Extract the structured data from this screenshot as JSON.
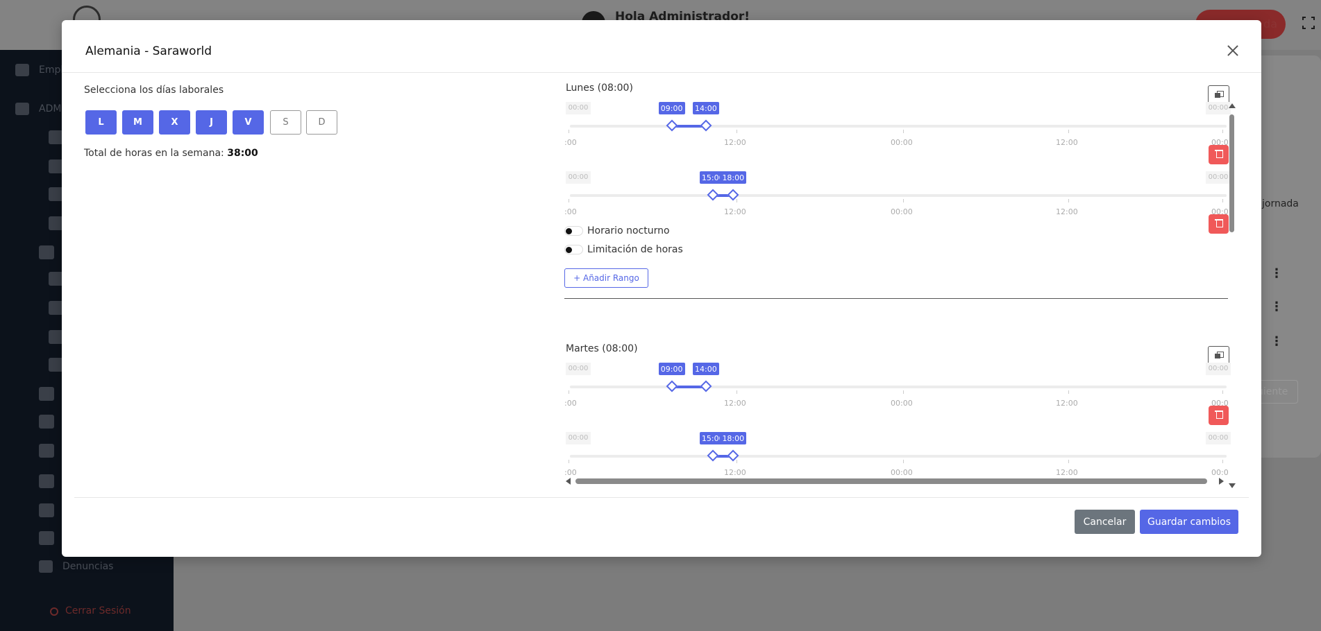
{
  "background": {
    "greeting": "Hola Administrador!",
    "header_button": "da",
    "sidebar": {
      "items": [
        "Empl",
        "ADMI"
      ],
      "bottom_item": "Denuncias",
      "logout": "Cerrar Sesión"
    },
    "main": {
      "jornada": "jornada",
      "siguiente": "uiente"
    }
  },
  "modal": {
    "title": "Alemania - Saraworld",
    "days_label": "Selecciona los días laborales",
    "days": [
      {
        "label": "L",
        "selected": true
      },
      {
        "label": "M",
        "selected": true
      },
      {
        "label": "X",
        "selected": true
      },
      {
        "label": "J",
        "selected": true
      },
      {
        "label": "V",
        "selected": true
      },
      {
        "label": "S",
        "selected": false
      },
      {
        "label": "D",
        "selected": false
      }
    ],
    "total_hours_label": "Total de horas en la semana:",
    "total_hours_value": "38:00",
    "schedule": [
      {
        "day": "Lunes (08:00)",
        "ranges": [
          {
            "start": "09:00",
            "end": "14:00"
          },
          {
            "start": "15:00",
            "end": "18:00"
          }
        ],
        "edge_label": "00:00",
        "axis_labels": [
          ":00",
          "12:00",
          "00:00",
          "12:00",
          "00:0"
        ]
      },
      {
        "day": "Martes (08:00)",
        "ranges": [
          {
            "start": "09:00",
            "end": "14:00"
          },
          {
            "start": "15:00",
            "end": "18:00"
          }
        ],
        "edge_label": "00:00",
        "axis_labels": [
          ":00",
          "12:00",
          "00:00",
          "12:00",
          "00:0"
        ]
      }
    ],
    "toggles": {
      "night": "Horario nocturno",
      "limit": "Limitación de horas"
    },
    "add_range": "+ Añadir Rango",
    "cancel": "Cancelar",
    "save": "Guardar cambios"
  },
  "colors": {
    "primary": "#5567e6",
    "danger": "#f05959",
    "secondary": "#6c757d"
  }
}
